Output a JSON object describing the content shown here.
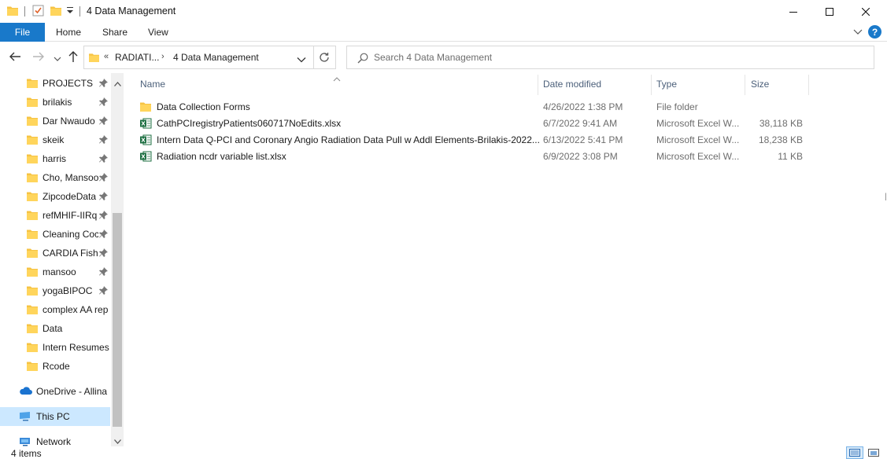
{
  "window": {
    "title": "4 Data Management"
  },
  "titlebar": {
    "icons": [
      "folder-icon",
      "properties-check-icon",
      "new-folder-icon",
      "customize-dropdown-icon"
    ],
    "controls": [
      "minimize-icon",
      "maximize-icon",
      "close-icon"
    ]
  },
  "ribbon": {
    "file_label": "File",
    "tabs": [
      {
        "label": "Home"
      },
      {
        "label": "Share"
      },
      {
        "label": "View"
      }
    ],
    "accent": "#1979ca"
  },
  "address": {
    "overflow": "«",
    "segments": [
      "RADIATI...",
      "4 Data Management"
    ],
    "separator": "›"
  },
  "search": {
    "placeholder": "Search 4 Data Management"
  },
  "navpane": {
    "items": [
      {
        "label": "PROJECTS",
        "pinned": true
      },
      {
        "label": "brilakis",
        "pinned": true
      },
      {
        "label": "Dar Nwaudo",
        "pinned": true
      },
      {
        "label": "skeik",
        "pinned": true
      },
      {
        "label": "harris",
        "pinned": true
      },
      {
        "label": "Cho, Mansoo",
        "pinned": true
      },
      {
        "label": "ZipcodeData",
        "pinned": true
      },
      {
        "label": "refMHIF-IIRq",
        "pinned": true
      },
      {
        "label": "Cleaning Coc",
        "pinned": true
      },
      {
        "label": "CARDIA Fish",
        "pinned": true
      },
      {
        "label": "mansoo",
        "pinned": true
      },
      {
        "label": "yogaBIPOC",
        "pinned": true
      },
      {
        "label": "complex AA rep",
        "pinned": false
      },
      {
        "label": "Data",
        "pinned": false
      },
      {
        "label": "Intern Resumes",
        "pinned": false
      },
      {
        "label": "Rcode",
        "pinned": false
      }
    ],
    "onedrive": "OneDrive - Allina",
    "thispc": "This PC",
    "network": "Network"
  },
  "columns": {
    "name": "Name",
    "date": "Date modified",
    "type": "Type",
    "size": "Size"
  },
  "files": [
    {
      "name": "Data Collection Forms",
      "date": "4/26/2022 1:38 PM",
      "type": "File folder",
      "size": "",
      "icon": "folder-icon"
    },
    {
      "name": "CathPCIregistryPatients060717NoEdits.xlsx",
      "date": "6/7/2022 9:41 AM",
      "type": "Microsoft Excel W...",
      "size": "38,118 KB",
      "icon": "excel-icon"
    },
    {
      "name": "Intern Data Q-PCI and Coronary Angio Radiation Data Pull w Addl Elements-Brilakis-2022...",
      "date": "6/13/2022 5:41 PM",
      "type": "Microsoft Excel W...",
      "size": "18,238 KB",
      "icon": "excel-icon"
    },
    {
      "name": "Radiation ncdr variable list.xlsx",
      "date": "6/9/2022 3:08 PM",
      "type": "Microsoft Excel W...",
      "size": "11 KB",
      "icon": "excel-icon"
    }
  ],
  "status": {
    "count": "4 items"
  },
  "colors": {
    "folder": "#f6c343",
    "excel": "#1d6f42",
    "selection": "#cce8ff",
    "header_text": "#4c607a"
  }
}
